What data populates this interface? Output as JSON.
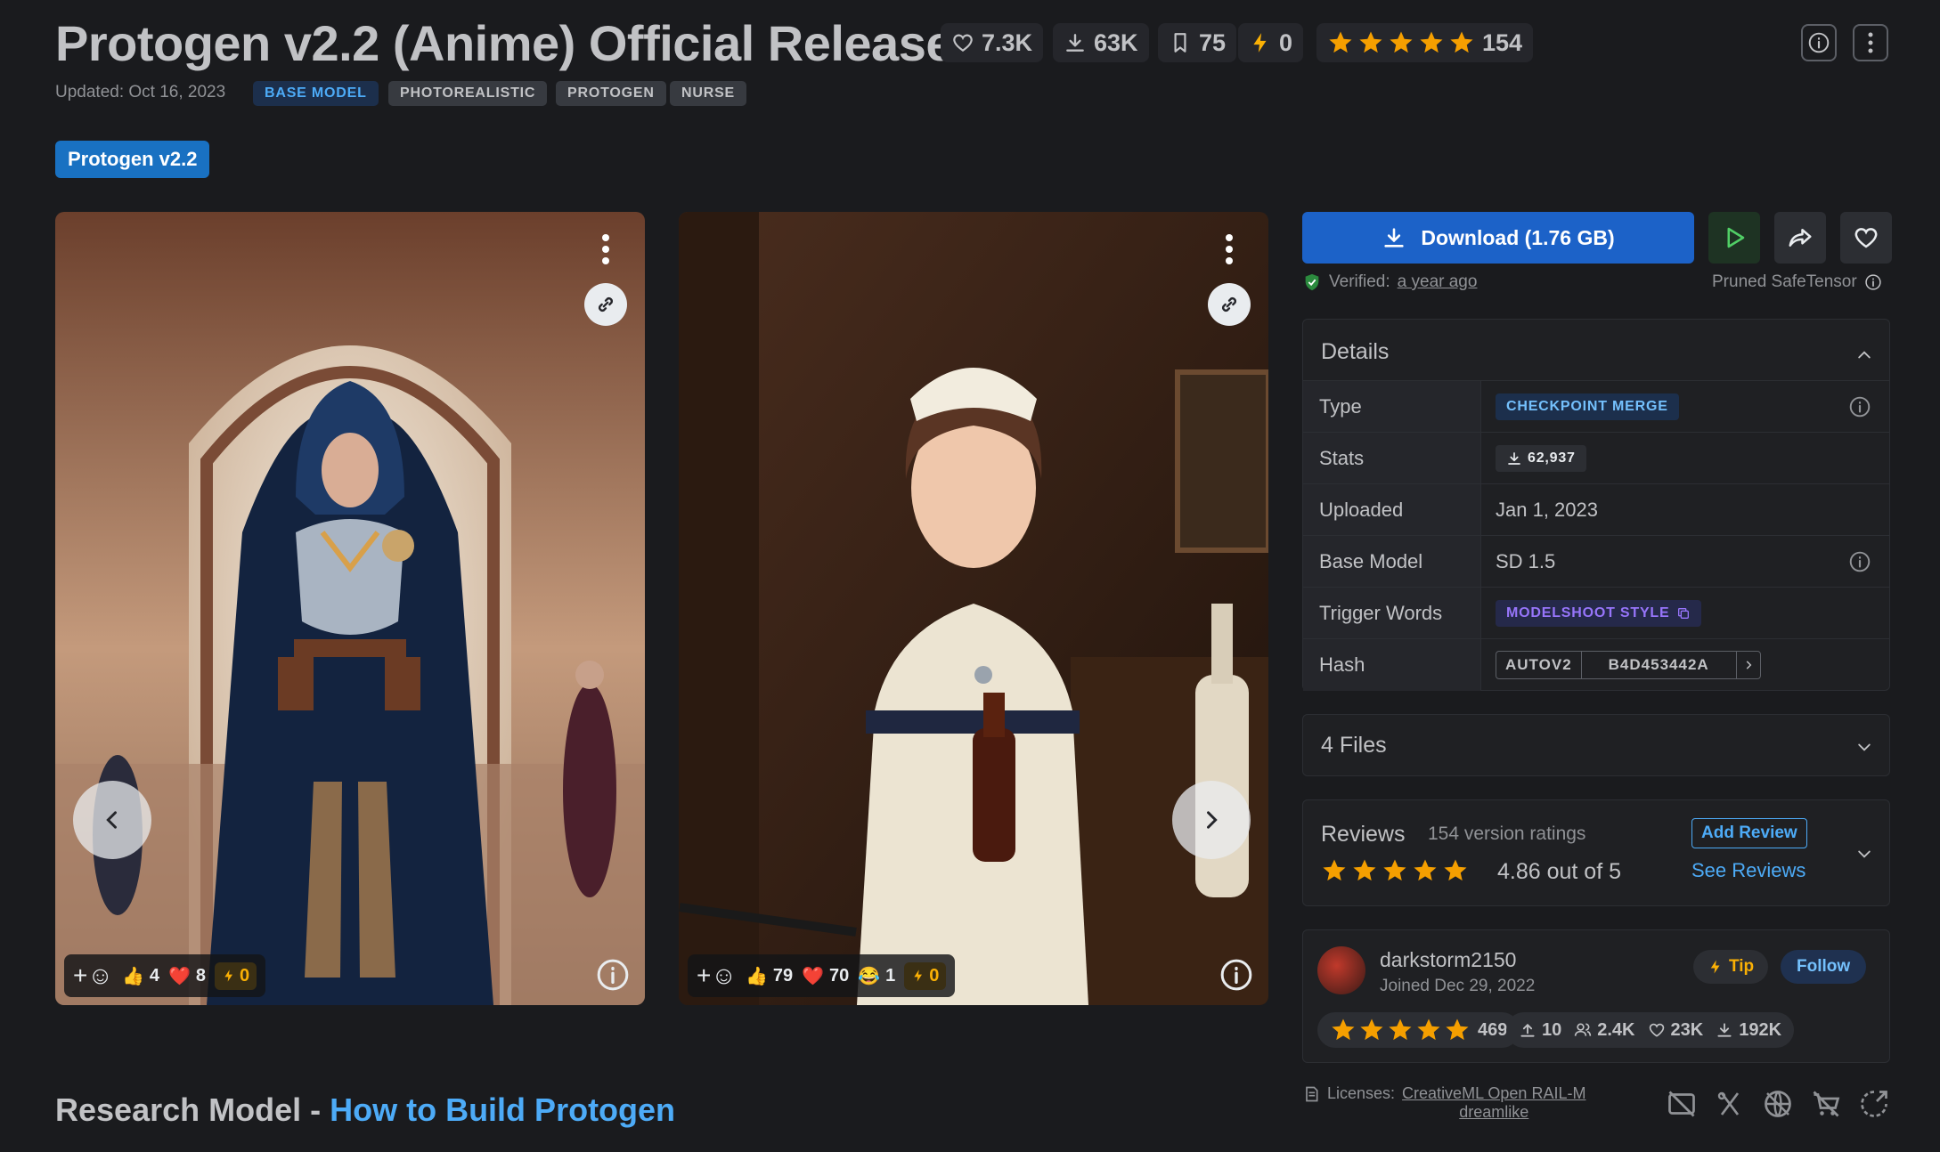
{
  "header": {
    "title": "Protogen v2.2 (Anime) Official Release",
    "stats": {
      "likes": "7.3K",
      "downloads": "63K",
      "bookmarks": "75",
      "tips": "0",
      "ratings": "154"
    },
    "rating_stars": 5,
    "updated": "Updated: Oct 16, 2023",
    "tags": [
      "BASE MODEL",
      "PHOTOREALISTIC",
      "PROTOGEN",
      "NURSE"
    ],
    "version_button": "Protogen v2.2"
  },
  "images": [
    {
      "reactions": {
        "thumbs": "4",
        "hearts": "8",
        "tips": "0"
      }
    },
    {
      "reactions": {
        "thumbs": "79",
        "hearts": "70",
        "laugh": "1",
        "tips": "0"
      }
    }
  ],
  "download": {
    "label": "Download (1.76 GB)",
    "verified_label": "Verified:",
    "verified_when": "a year ago",
    "format": "Pruned SafeTensor"
  },
  "details": {
    "heading": "Details",
    "type_label": "Type",
    "type_value": "CHECKPOINT MERGE",
    "stats_label": "Stats",
    "stats_value": "62,937",
    "uploaded_label": "Uploaded",
    "uploaded_value": "Jan 1, 2023",
    "base_model_label": "Base Model",
    "base_model_value": "SD 1.5",
    "trigger_label": "Trigger Words",
    "trigger_value": "MODELSHOOT STYLE",
    "hash_label": "Hash",
    "hash_type": "AUTOV2",
    "hash_value": "B4D453442A"
  },
  "files": {
    "label": "4 Files"
  },
  "reviews": {
    "heading": "Reviews",
    "count_label": "154 version ratings",
    "score": "4.86 out of 5",
    "add_review": "Add Review",
    "see_reviews": "See Reviews"
  },
  "creator": {
    "name": "darkstorm2150",
    "joined": "Joined Dec 29, 2022",
    "tip": "Tip",
    "follow": "Follow",
    "rating_count": "469",
    "uploads": "10",
    "followers": "2.4K",
    "likes": "23K",
    "downloads": "192K"
  },
  "footer": {
    "research_prefix": "Research Model - ",
    "research_link": "How to Build Protogen",
    "licenses_label": "Licenses:",
    "license_1": "CreativeML Open RAIL-M",
    "license_2": "dreamlike"
  },
  "colors": {
    "accent": "#1c62c8",
    "star": "#f59f00",
    "link": "#4dabf7",
    "background": "#1a1b1e"
  }
}
